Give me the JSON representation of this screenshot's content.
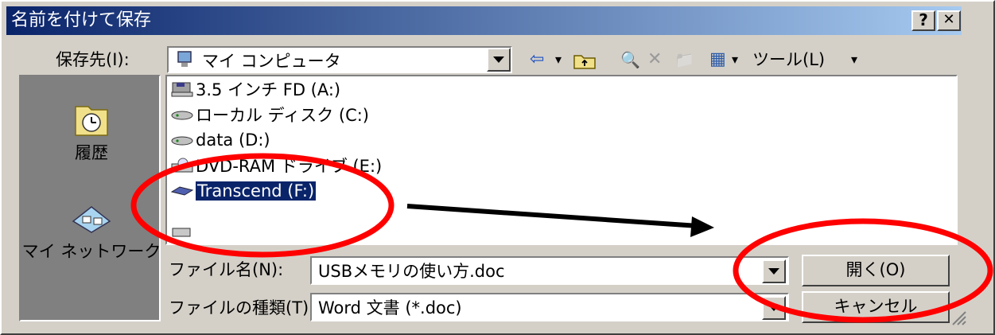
{
  "window": {
    "title": "名前を付けて保存",
    "help_glyph": "?",
    "close_glyph": "✕"
  },
  "toolbar": {
    "save_in_label": "保存先(I):",
    "save_in_value": "マイ コンピュータ",
    "tools_label": "ツール(L)",
    "back_glyph": "⇦",
    "search_glyph": "🔍",
    "delete_glyph": "✕",
    "new_folder_glyph": "📁",
    "views_glyph": "▦",
    "caret": "▾"
  },
  "places": [
    {
      "label": "履歴",
      "icon": "history-icon"
    },
    {
      "label": "マイ ネットワーク",
      "icon": "network-icon"
    }
  ],
  "files": [
    {
      "label": "3.5 インチ FD (A:)",
      "icon": "floppy-drive-icon"
    },
    {
      "label": "ローカル ディスク (C:)",
      "icon": "hard-disk-icon"
    },
    {
      "label": "data (D:)",
      "icon": "hard-disk-icon"
    },
    {
      "label": "DVD-RAM ドライブ (E:)",
      "icon": "dvd-drive-icon"
    },
    {
      "label": "Transcend (F:)",
      "icon": "removable-drive-icon",
      "selected": true
    }
  ],
  "form": {
    "filename_label": "ファイル名(N):",
    "filename_value": "USBメモリの使い方.doc",
    "filetype_label": "ファイルの種類(T):",
    "filetype_value": "Word 文書 (*.doc)",
    "open_button": "開く(O)",
    "cancel_button": "キャンセル"
  },
  "annotation_colors": {
    "ellipse": "#ff0000",
    "arrow": "#000000",
    "selection": "#0a246a"
  }
}
